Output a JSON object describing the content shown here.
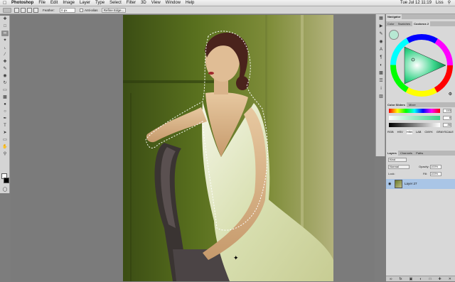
{
  "menubar": {
    "apple": "",
    "app_name": "Photoshop",
    "menus": [
      "File",
      "Edit",
      "Image",
      "Layer",
      "Type",
      "Select",
      "Filter",
      "3D",
      "View",
      "Window",
      "Help"
    ],
    "clock": "Tue Jul 12  11:19",
    "user": "Liss"
  },
  "options": {
    "feather_label": "Feather:",
    "feather_value": "0 px",
    "antialias_label": "Anti-alias",
    "refine_button": "Refine Edge..."
  },
  "toolbox": {
    "tools": [
      "move",
      "marquee",
      "lasso",
      "quick-select",
      "crop",
      "eyedropper",
      "healing",
      "brush",
      "clone",
      "history",
      "eraser",
      "gradient",
      "blur",
      "dodge",
      "pen",
      "type",
      "path-select",
      "shape",
      "hand",
      "zoom"
    ],
    "active": "lasso",
    "fg_color": "#ffffff",
    "bg_color": "#000000"
  },
  "navigator": {
    "tabs": [
      "Navigator"
    ]
  },
  "coolorus": {
    "tabs": [
      "Color",
      "Swatches",
      "Coolorus 2"
    ],
    "selected_color": "#b7e8d3"
  },
  "color_sliders": {
    "tabs": [
      "Color Sliders",
      "Mixer"
    ],
    "values": [
      "153",
      "8",
      "86"
    ],
    "modes": [
      "RGB",
      "HSV",
      "HSB",
      "LAB",
      "CMYK",
      "GRAYSCALE"
    ],
    "active_mode": "HSB"
  },
  "layers": {
    "tabs": [
      "Layers",
      "Channels",
      "Paths"
    ],
    "kind_label": "Kind",
    "blend_mode": "Normal",
    "opacity_label": "Opacity:",
    "opacity_value": "100%",
    "lock_label": "Lock:",
    "fill_label": "Fill:",
    "fill_value": "100%",
    "items": [
      {
        "name": "Layer 27",
        "selected": true
      }
    ]
  },
  "colors": {
    "accent": "#a9c5e6",
    "canvas_bg": "#7b7b7b",
    "panel_bg": "#d8d8d8"
  }
}
